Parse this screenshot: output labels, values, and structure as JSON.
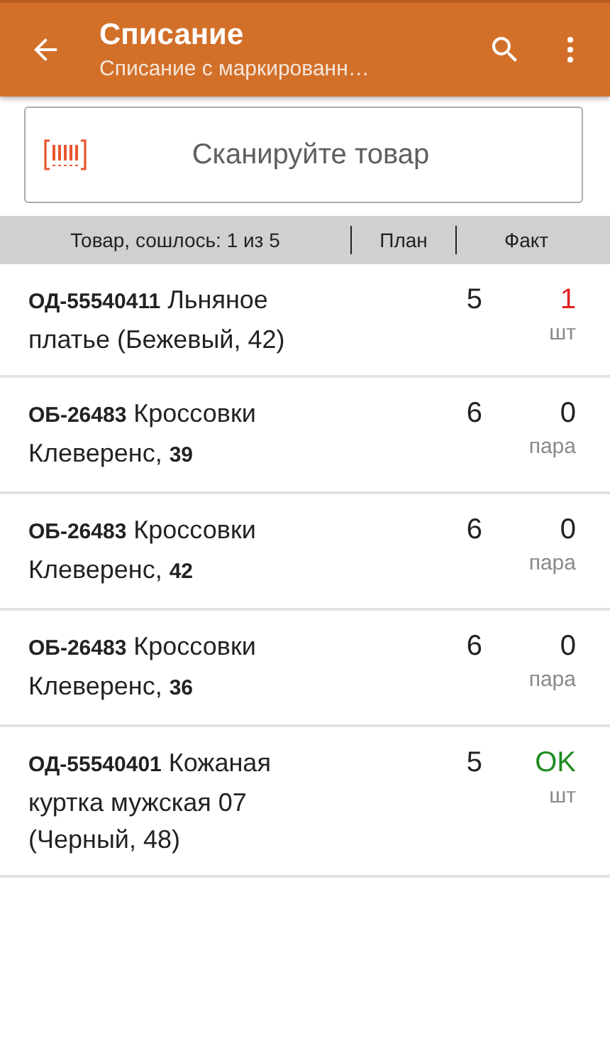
{
  "app_bar": {
    "title": "Списание",
    "subtitle": "Списание с маркированн…"
  },
  "scan_field": {
    "placeholder": "Сканируйте товар"
  },
  "table": {
    "columns": [
      "Товар, сошлось: 1 из 5",
      "План",
      "Факт"
    ],
    "rows": [
      {
        "name": "**ОД-55540411** Льняное платье (Бежевый, 42)",
        "plan": "5",
        "fact": "1",
        "unit": "шт",
        "color": "#e02020"
      },
      {
        "name": "**ОБ-26483** Кроссовки Клеверенс, **39**",
        "plan": "6",
        "fact": "0",
        "unit": "пара",
        "color": "#222222"
      },
      {
        "name": "**ОБ-26483** Кроссовки Клеверенс, **42**",
        "plan": "6",
        "fact": "0",
        "unit": "пара",
        "color": "#222222"
      },
      {
        "name": "**ОБ-26483** Кроссовки Клеверенс, **36**",
        "plan": "6",
        "fact": "0",
        "unit": "пара",
        "color": "#222222"
      },
      {
        "name": "**ОД-55540401** Кожаная куртка мужская 07 (Черный, 48)",
        "plan": "5",
        "fact": "OK",
        "unit": "шт",
        "color": "#1e8c1e"
      }
    ]
  }
}
